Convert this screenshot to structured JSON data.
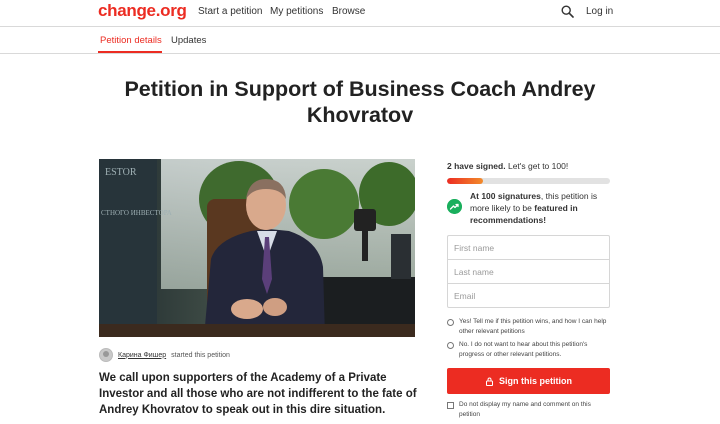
{
  "header": {
    "logo": "change.org",
    "nav": [
      "Start a petition",
      "My petitions",
      "Browse"
    ],
    "login": "Log in"
  },
  "tabs": {
    "details": "Petition details",
    "updates": "Updates"
  },
  "petition": {
    "title": "Petition in Support of Business Coach Andrey Khovratov",
    "starter_name": "Карина Фишер",
    "starter_suffix": "started this petition",
    "callout": "We call upon supporters of the Academy of a Private Investor and all those who are not indifferent to the fate of Andrey Khovratov to speak out in this dire situation."
  },
  "sidebar": {
    "signed_strong": "2 have signed.",
    "signed_rest": "Let's get to 100!",
    "progress_fraction": 0.22,
    "feature_strong1": "At 100 signatures",
    "feature_mid": ", this petition is more likely to be ",
    "feature_strong2": "featured in recommendations!",
    "first_name_placeholder": "First name",
    "last_name_placeholder": "Last name",
    "email_placeholder": "Email",
    "option_yes": "Yes! Tell me if this petition wins, and how I can help other relevant petitions",
    "option_no": "No. I do not want to hear about this petition's progress or other relevant petitions.",
    "sign_button": "Sign this petition",
    "hide_name": "Do not display my name and comment on this petition"
  },
  "colors": {
    "brand": "#ec2c22",
    "success": "#1aaf5d"
  }
}
